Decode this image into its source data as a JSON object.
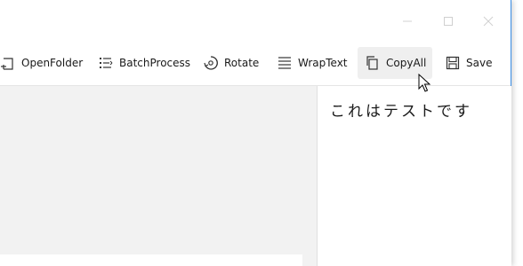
{
  "toolbar": {
    "buttons": [
      {
        "label": "OpenFolder",
        "icon": "open-folder-icon"
      },
      {
        "label": "BatchProcess",
        "icon": "batch-process-icon"
      },
      {
        "label": "Rotate",
        "icon": "rotate-icon"
      },
      {
        "label": "WrapText",
        "icon": "wrap-text-icon"
      },
      {
        "label": "CopyAll",
        "icon": "copy-icon"
      },
      {
        "label": "Save",
        "icon": "save-icon"
      }
    ]
  },
  "preview": {
    "text": "これはテストです"
  },
  "colors": {
    "accent_border": "#3a8ee6",
    "background": "#f2f2f2",
    "hover": "#efefef"
  }
}
